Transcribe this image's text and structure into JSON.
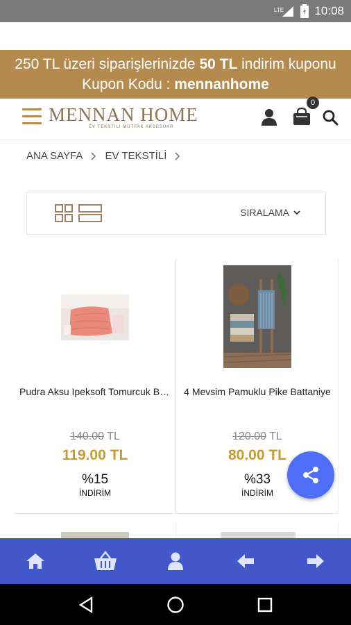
{
  "status_bar": {
    "network": "LTE",
    "time": "10:08"
  },
  "promo": {
    "line1_pre": "250 TL üzeri siparişlerinizde ",
    "line1_bold": "50 TL",
    "line1_post": " indirim kuponu",
    "line2_pre": "Kupon Kodu : ",
    "line2_bold": "mennanhome"
  },
  "header": {
    "logo_text": "MENNAN HOME",
    "logo_tagline": "EV TEKSTİLİ MUTFAK AKSESUAR",
    "cart_count": "0"
  },
  "breadcrumb": {
    "items": [
      "ANA SAYFA",
      "EV TEKSTİLİ"
    ]
  },
  "toolbar": {
    "sort_label": "SIRALAMA"
  },
  "products": [
    {
      "name": "Pudra Aksu Ipeksoft Tomurcuk Battaniye",
      "old_price": "140.00",
      "currency": "TL",
      "new_price": "119.00 TL",
      "discount_pct": "%15",
      "discount_label": "İNDİRİM"
    },
    {
      "name": "4 Mevsim Pamuklu Pike Battaniye",
      "old_price": "120.00",
      "currency": "TL",
      "new_price": "80.00 TL",
      "discount_pct": "%33",
      "discount_label": "İNDİRİM"
    }
  ],
  "colors": {
    "brand_gold": "#b48a4f",
    "price_gold": "#c89b2e",
    "nav_blue": "#4257c9",
    "fab_blue": "#4f6ef7"
  },
  "icons": {
    "bottom_nav": [
      "home-icon",
      "basket-icon",
      "user-icon",
      "arrow-left-icon",
      "arrow-right-icon"
    ],
    "android_nav": [
      "back-icon",
      "home-circle-icon",
      "recents-icon"
    ]
  }
}
